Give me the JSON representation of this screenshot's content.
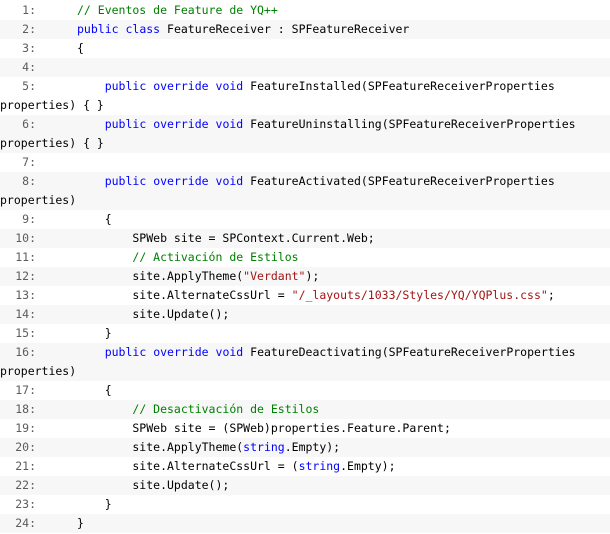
{
  "lines": [
    {
      "num": "1:",
      "segs": [
        [
          "// Eventos de Feature de YQ++",
          "cm"
        ]
      ]
    },
    {
      "num": "2:",
      "segs": [
        [
          "public",
          "kw"
        ],
        [
          " ",
          ""
        ],
        [
          "class",
          "kw"
        ],
        [
          " FeatureReceiver : SPFeatureReceiver",
          ""
        ]
      ]
    },
    {
      "num": "3:",
      "segs": [
        [
          "{",
          ""
        ]
      ]
    },
    {
      "num": "4:",
      "segs": []
    },
    {
      "num": "5:",
      "segs": [
        [
          "    ",
          ""
        ],
        [
          "public",
          "kw"
        ],
        [
          " ",
          ""
        ],
        [
          "override",
          "kw"
        ],
        [
          " ",
          ""
        ],
        [
          "void",
          "kw"
        ],
        [
          " FeatureInstalled(SPFeatureReceiverProperties",
          ""
        ]
      ],
      "cont": "properties) { }"
    },
    {
      "num": "6:",
      "segs": [
        [
          "    ",
          ""
        ],
        [
          "public",
          "kw"
        ],
        [
          " ",
          ""
        ],
        [
          "override",
          "kw"
        ],
        [
          " ",
          ""
        ],
        [
          "void",
          "kw"
        ],
        [
          " FeatureUninstalling(SPFeatureReceiverProperties",
          ""
        ]
      ],
      "cont": "properties) { }"
    },
    {
      "num": "7:",
      "segs": []
    },
    {
      "num": "8:",
      "segs": [
        [
          "    ",
          ""
        ],
        [
          "public",
          "kw"
        ],
        [
          " ",
          ""
        ],
        [
          "override",
          "kw"
        ],
        [
          " ",
          ""
        ],
        [
          "void",
          "kw"
        ],
        [
          " FeatureActivated(SPFeatureReceiverProperties",
          ""
        ]
      ],
      "cont": "properties)"
    },
    {
      "num": "9:",
      "segs": [
        [
          "    {",
          ""
        ]
      ]
    },
    {
      "num": "10:",
      "segs": [
        [
          "        SPWeb site = SPContext.Current.Web;",
          ""
        ]
      ]
    },
    {
      "num": "11:",
      "segs": [
        [
          "        ",
          ""
        ],
        [
          "// Activación de Estilos",
          "cm"
        ]
      ]
    },
    {
      "num": "12:",
      "segs": [
        [
          "        site.ApplyTheme(",
          ""
        ],
        [
          "\"Verdant\"",
          "st"
        ],
        [
          ");",
          ""
        ]
      ]
    },
    {
      "num": "13:",
      "segs": [
        [
          "        site.AlternateCssUrl = ",
          ""
        ],
        [
          "\"/_layouts/1033/Styles/YQ/YQPlus.css\"",
          "st"
        ],
        [
          ";",
          ""
        ]
      ]
    },
    {
      "num": "14:",
      "segs": [
        [
          "        site.Update();",
          ""
        ]
      ]
    },
    {
      "num": "15:",
      "segs": [
        [
          "    }",
          ""
        ]
      ]
    },
    {
      "num": "16:",
      "segs": [
        [
          "    ",
          ""
        ],
        [
          "public",
          "kw"
        ],
        [
          " ",
          ""
        ],
        [
          "override",
          "kw"
        ],
        [
          " ",
          ""
        ],
        [
          "void",
          "kw"
        ],
        [
          " FeatureDeactivating(SPFeatureReceiverProperties",
          ""
        ]
      ],
      "cont": "properties)"
    },
    {
      "num": "17:",
      "segs": [
        [
          "    {",
          ""
        ]
      ]
    },
    {
      "num": "18:",
      "segs": [
        [
          "        ",
          ""
        ],
        [
          "// Desactivación de Estilos",
          "cm"
        ]
      ]
    },
    {
      "num": "19:",
      "segs": [
        [
          "        SPWeb site = (SPWeb)properties.Feature.Parent;",
          ""
        ]
      ]
    },
    {
      "num": "20:",
      "segs": [
        [
          "        site.ApplyTheme(",
          ""
        ],
        [
          "string",
          "kw"
        ],
        [
          ".Empty);",
          ""
        ]
      ]
    },
    {
      "num": "21:",
      "segs": [
        [
          "        site.AlternateCssUrl = (",
          ""
        ],
        [
          "string",
          "kw"
        ],
        [
          ".Empty);",
          ""
        ]
      ]
    },
    {
      "num": "22:",
      "segs": [
        [
          "        site.Update();",
          ""
        ]
      ]
    },
    {
      "num": "23:",
      "segs": [
        [
          "    }",
          ""
        ]
      ]
    },
    {
      "num": "24:",
      "segs": [
        [
          "}",
          ""
        ]
      ]
    }
  ],
  "colors": {
    "keyword": "#0000ff",
    "comment": "#008000",
    "string": "#a31515",
    "text": "#000000",
    "line_number": "#5c5c5c",
    "alt_row_background": "#f7f7f7"
  }
}
